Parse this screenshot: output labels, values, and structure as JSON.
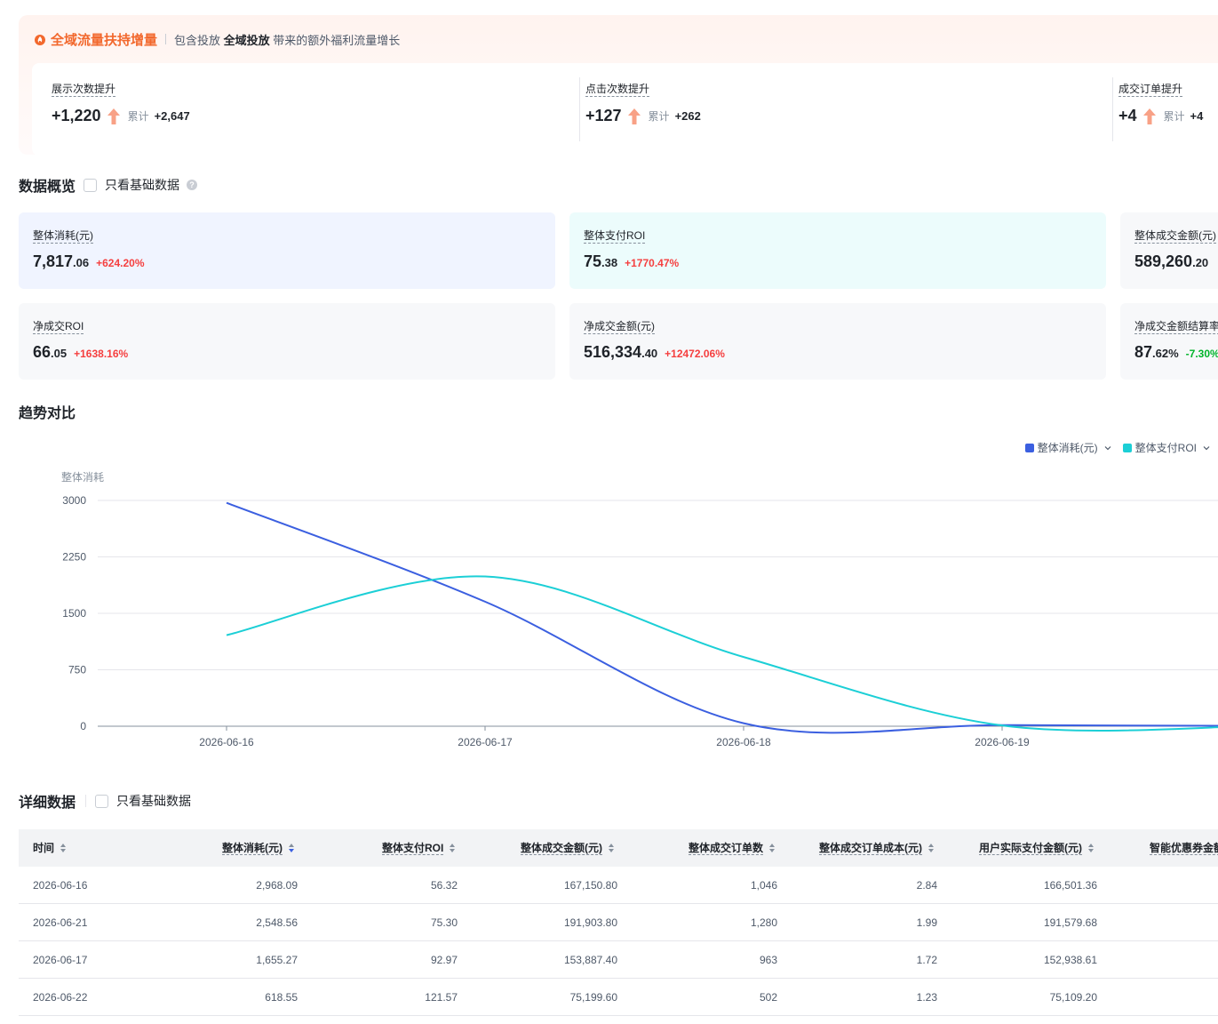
{
  "banner": {
    "title": "全域流量扶持增量",
    "desc_prefix": "包含投放",
    "desc_bold": "全域投放",
    "desc_suffix": "带来的额外福利流量增长",
    "items": [
      {
        "label": "展示次数提升",
        "value": "+1,220",
        "acc_label": "累计",
        "acc_value": "+2,647"
      },
      {
        "label": "点击次数提升",
        "value": "+127",
        "acc_label": "累计",
        "acc_value": "+262"
      },
      {
        "label": "成交订单提升",
        "value": "+4",
        "acc_label": "累计",
        "acc_value": "+4"
      }
    ],
    "accent_color": "#f2682d"
  },
  "overview": {
    "title": "数据概览",
    "checkbox_label": "只看基础数据",
    "help_glyph": "?",
    "cards": [
      {
        "label": "整体消耗(元)",
        "int": "7,817",
        "dec": ".06",
        "change": "+624.20%",
        "dir": "up"
      },
      {
        "label": "整体支付ROI",
        "int": "75",
        "dec": ".38",
        "change": "+1770.47%",
        "dir": "up"
      },
      {
        "label": "整体成交金额(元)",
        "int": "589,260",
        "dec": ".20",
        "change": "",
        "dir": "up"
      },
      {
        "label": "净成交ROI",
        "int": "66",
        "dec": ".05",
        "change": "+1638.16%",
        "dir": "up"
      },
      {
        "label": "净成交金额(元)",
        "int": "516,334",
        "dec": ".40",
        "change": "+12472.06%",
        "dir": "up"
      },
      {
        "label": "净成交金额结算率",
        "int": "87",
        "dec": ".62%",
        "change": "-7.30%",
        "dir": "down"
      }
    ]
  },
  "trend": {
    "title": "趋势对比",
    "legend": [
      {
        "name": "整体消耗(元)",
        "color": "#3b5fe0"
      },
      {
        "name": "整体支付ROI",
        "color": "#1ccfd6"
      }
    ]
  },
  "chart_data": {
    "type": "line",
    "ylabel": "整体消耗",
    "ylim": [
      0,
      3000
    ],
    "yticks": [
      "3000",
      "2250",
      "1500",
      "750",
      "0"
    ],
    "x": [
      "2026-06-16",
      "2026-06-17",
      "2026-06-18",
      "2026-06-19"
    ],
    "grid": true,
    "legend_position": "top-right",
    "series": [
      {
        "name": "整体消耗(元)",
        "color": "#3b5fe0",
        "values": [
          2968,
          1655,
          40,
          15,
          5
        ]
      },
      {
        "name": "整体支付ROI",
        "color": "#1ccfd6",
        "values": [
          1210,
          1990,
          920,
          10,
          5
        ]
      }
    ]
  },
  "detail": {
    "title": "详细数据",
    "checkbox_label": "只看基础数据",
    "columns": [
      {
        "label": "时间",
        "dashed": false,
        "active": false
      },
      {
        "label": "整体消耗(元)",
        "dashed": true,
        "active": true
      },
      {
        "label": "整体支付ROI",
        "dashed": true,
        "active": false
      },
      {
        "label": "整体成交金额(元)",
        "dashed": true,
        "active": false
      },
      {
        "label": "整体成交订单数",
        "dashed": true,
        "active": false
      },
      {
        "label": "整体成交订单成本(元)",
        "dashed": true,
        "active": false
      },
      {
        "label": "用户实际支付金额(元)",
        "dashed": true,
        "active": false
      },
      {
        "label": "智能优惠券金额",
        "dashed": true,
        "active": false
      }
    ],
    "rows": [
      [
        "2026-06-16",
        "2,968.09",
        "56.32",
        "167,150.80",
        "1,046",
        "2.84",
        "166,501.36"
      ],
      [
        "2026-06-21",
        "2,548.56",
        "75.30",
        "191,903.80",
        "1,280",
        "1.99",
        "191,579.68"
      ],
      [
        "2026-06-17",
        "1,655.27",
        "92.97",
        "153,887.40",
        "963",
        "1.72",
        "152,938.61"
      ],
      [
        "2026-06-22",
        "618.55",
        "121.57",
        "75,199.60",
        "502",
        "1.23",
        "75,109.20"
      ]
    ]
  }
}
